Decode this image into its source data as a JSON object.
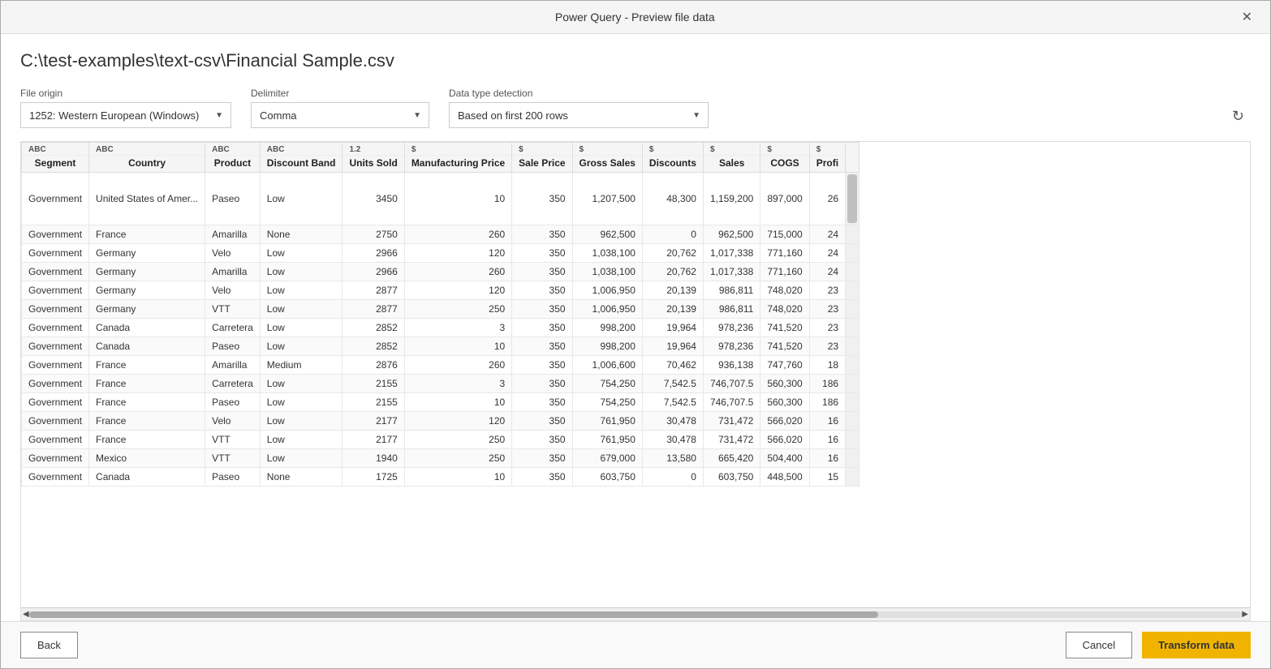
{
  "dialog": {
    "title": "Power Query - Preview file data",
    "file_path": "C:\\test-examples\\text-csv\\Financial Sample.csv"
  },
  "controls": {
    "file_origin_label": "File origin",
    "file_origin_value": "1252: Western European (Windows)",
    "delimiter_label": "Delimiter",
    "delimiter_value": "Comma",
    "data_type_label": "Data type detection",
    "data_type_value": "Based on first 200 rows"
  },
  "columns": [
    {
      "name": "Segment",
      "type": "ABC",
      "type_label": "ABC"
    },
    {
      "name": "Country",
      "type": "ABC",
      "type_label": "ABC"
    },
    {
      "name": "Product",
      "type": "ABC",
      "type_label": "ABC"
    },
    {
      "name": "Discount Band",
      "type": "ABC",
      "type_label": "ABC"
    },
    {
      "name": "Units Sold",
      "type": "1.2",
      "type_label": "1.2"
    },
    {
      "name": "Manufacturing Price",
      "type": "$",
      "type_label": "$"
    },
    {
      "name": "Sale Price",
      "type": "$",
      "type_label": "$"
    },
    {
      "name": "Gross Sales",
      "type": "$",
      "type_label": "$"
    },
    {
      "name": "Discounts",
      "type": "$",
      "type_label": "$"
    },
    {
      "name": "Sales",
      "type": "$",
      "type_label": "$"
    },
    {
      "name": "COGS",
      "type": "$",
      "type_label": "$"
    },
    {
      "name": "Profi",
      "type": "$",
      "type_label": "$"
    }
  ],
  "rows": [
    [
      "Government",
      "United States of Amer...",
      "Paseo",
      "Low",
      "3450",
      "10",
      "350",
      "1,207,500",
      "48,300",
      "1,159,200",
      "897,000",
      "26"
    ],
    [
      "Government",
      "France",
      "Amarilla",
      "None",
      "2750",
      "260",
      "350",
      "962,500",
      "0",
      "962,500",
      "715,000",
      "24"
    ],
    [
      "Government",
      "Germany",
      "Velo",
      "Low",
      "2966",
      "120",
      "350",
      "1,038,100",
      "20,762",
      "1,017,338",
      "771,160",
      "24"
    ],
    [
      "Government",
      "Germany",
      "Amarilla",
      "Low",
      "2966",
      "260",
      "350",
      "1,038,100",
      "20,762",
      "1,017,338",
      "771,160",
      "24"
    ],
    [
      "Government",
      "Germany",
      "Velo",
      "Low",
      "2877",
      "120",
      "350",
      "1,006,950",
      "20,139",
      "986,811",
      "748,020",
      "23"
    ],
    [
      "Government",
      "Germany",
      "VTT",
      "Low",
      "2877",
      "250",
      "350",
      "1,006,950",
      "20,139",
      "986,811",
      "748,020",
      "23"
    ],
    [
      "Government",
      "Canada",
      "Carretera",
      "Low",
      "2852",
      "3",
      "350",
      "998,200",
      "19,964",
      "978,236",
      "741,520",
      "23"
    ],
    [
      "Government",
      "Canada",
      "Paseo",
      "Low",
      "2852",
      "10",
      "350",
      "998,200",
      "19,964",
      "978,236",
      "741,520",
      "23"
    ],
    [
      "Government",
      "France",
      "Amarilla",
      "Medium",
      "2876",
      "260",
      "350",
      "1,006,600",
      "70,462",
      "936,138",
      "747,760",
      "18"
    ],
    [
      "Government",
      "France",
      "Carretera",
      "Low",
      "2155",
      "3",
      "350",
      "754,250",
      "7,542.5",
      "746,707.5",
      "560,300",
      "186"
    ],
    [
      "Government",
      "France",
      "Paseo",
      "Low",
      "2155",
      "10",
      "350",
      "754,250",
      "7,542.5",
      "746,707.5",
      "560,300",
      "186"
    ],
    [
      "Government",
      "France",
      "Velo",
      "Low",
      "2177",
      "120",
      "350",
      "761,950",
      "30,478",
      "731,472",
      "566,020",
      "16"
    ],
    [
      "Government",
      "France",
      "VTT",
      "Low",
      "2177",
      "250",
      "350",
      "761,950",
      "30,478",
      "731,472",
      "566,020",
      "16"
    ],
    [
      "Government",
      "Mexico",
      "VTT",
      "Low",
      "1940",
      "250",
      "350",
      "679,000",
      "13,580",
      "665,420",
      "504,400",
      "16"
    ],
    [
      "Government",
      "Canada",
      "Paseo",
      "None",
      "1725",
      "10",
      "350",
      "603,750",
      "0",
      "603,750",
      "448,500",
      "15"
    ]
  ],
  "footer": {
    "back_label": "Back",
    "cancel_label": "Cancel",
    "transform_label": "Transform data"
  }
}
